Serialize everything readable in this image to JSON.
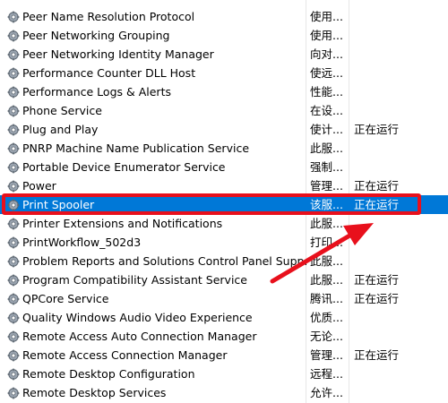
{
  "services": [
    {
      "name": "Peer Name Resolution Protocol",
      "desc": "使用...",
      "status": ""
    },
    {
      "name": "Peer Networking Grouping",
      "desc": "使用...",
      "status": ""
    },
    {
      "name": "Peer Networking Identity Manager",
      "desc": "向对...",
      "status": ""
    },
    {
      "name": "Performance Counter DLL Host",
      "desc": "使远...",
      "status": ""
    },
    {
      "name": "Performance Logs & Alerts",
      "desc": "性能...",
      "status": ""
    },
    {
      "name": "Phone Service",
      "desc": "在设...",
      "status": ""
    },
    {
      "name": "Plug and Play",
      "desc": "使计...",
      "status": "正在运行"
    },
    {
      "name": "PNRP Machine Name Publication Service",
      "desc": "此服...",
      "status": ""
    },
    {
      "name": "Portable Device Enumerator Service",
      "desc": "强制...",
      "status": ""
    },
    {
      "name": "Power",
      "desc": "管理...",
      "status": "正在运行"
    },
    {
      "name": "Print Spooler",
      "desc": "该服...",
      "status": "正在运行"
    },
    {
      "name": "Printer Extensions and Notifications",
      "desc": "此服...",
      "status": ""
    },
    {
      "name": "PrintWorkflow_502d3",
      "desc": "打印...",
      "status": ""
    },
    {
      "name": "Problem Reports and Solutions Control Panel Supp...",
      "desc": "此服...",
      "status": ""
    },
    {
      "name": "Program Compatibility Assistant Service",
      "desc": "此服...",
      "status": "正在运行"
    },
    {
      "name": "QPCore Service",
      "desc": "腾讯...",
      "status": "正在运行"
    },
    {
      "name": "Quality Windows Audio Video Experience",
      "desc": "优质...",
      "status": ""
    },
    {
      "name": "Remote Access Auto Connection Manager",
      "desc": "无论...",
      "status": ""
    },
    {
      "name": "Remote Access Connection Manager",
      "desc": "管理...",
      "status": "正在运行"
    },
    {
      "name": "Remote Desktop Configuration",
      "desc": "远程...",
      "status": ""
    },
    {
      "name": "Remote Desktop Services",
      "desc": "允许...",
      "status": ""
    }
  ],
  "selected_index": 10,
  "colors": {
    "selection": "#0078d7",
    "annotation": "#e8101c"
  },
  "icon": "gear-service-icon"
}
